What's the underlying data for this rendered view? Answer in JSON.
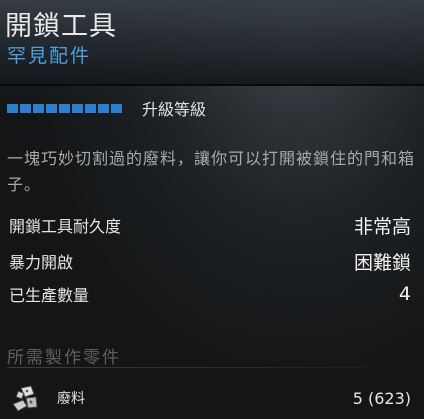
{
  "item": {
    "name": "開鎖工具",
    "rarity": "罕見配件"
  },
  "upgrade": {
    "label": "升級等級",
    "level": 9,
    "max_level": 9,
    "pip_color": "#2d7fd0"
  },
  "description": "一塊巧妙切割過的廢料，讓你可以打開被鎖住的門和箱子。",
  "stats": [
    {
      "label": "開鎖工具耐久度",
      "value": "非常高"
    },
    {
      "label": "暴力開啟",
      "value": "困難鎖"
    },
    {
      "label": "已生產數量",
      "value": "4"
    }
  ],
  "materials": {
    "title": "所需製作零件",
    "items": [
      {
        "name": "廢料",
        "count": "5 (623)",
        "icon": "scrap-metal-icon"
      }
    ]
  },
  "colors": {
    "rarity": "#4d9fdc",
    "title": "#e9e9e9",
    "description": "#a9a9a9"
  }
}
